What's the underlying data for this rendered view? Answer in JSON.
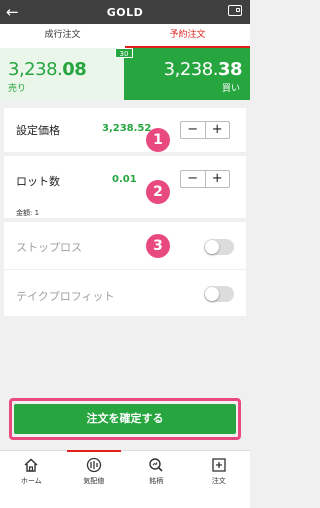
{
  "header": {
    "title": "GOLD",
    "back_glyph": "←"
  },
  "tabs": [
    {
      "label": "成行注文"
    },
    {
      "label": "予約注文"
    }
  ],
  "quote": {
    "sell_price_main": "3,238.",
    "sell_price_bold": "08",
    "sell_label": "売り",
    "buy_price_main": "3,238.",
    "buy_price_bold": "38",
    "buy_label": "買い",
    "spread": "30"
  },
  "form": {
    "price": {
      "label": "設定価格",
      "value": "3,238.52"
    },
    "lot": {
      "label": "ロット数",
      "value": "0.01",
      "amount": "金額: 1"
    },
    "stop_loss": {
      "label": "ストップロス"
    },
    "take_profit": {
      "label": "テイクプロフィット"
    },
    "stepper": {
      "minus": "−",
      "plus": "+"
    }
  },
  "markers": [
    "1",
    "2",
    "3"
  ],
  "confirm": {
    "label": "注文を確定する"
  },
  "nav": [
    {
      "label": "ホーム"
    },
    {
      "label": "気配値"
    },
    {
      "label": "銘柄"
    },
    {
      "label": "注文"
    }
  ],
  "colors": {
    "accent_green": "#27a640",
    "accent_red": "#e0221b",
    "highlight_pink": "#e84a7f",
    "header_bg": "#3f3f3f"
  }
}
